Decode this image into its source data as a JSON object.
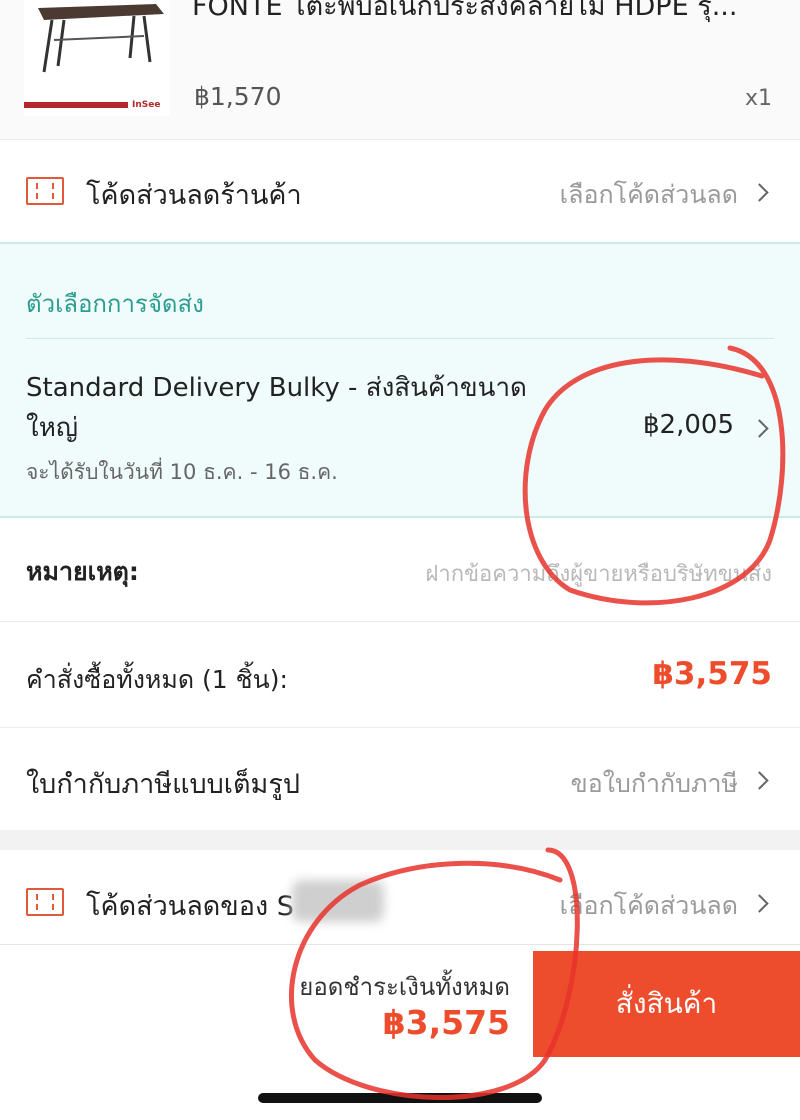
{
  "product": {
    "title": "FONTE โต๊ะพับอเนกประสงค์ลายไม้ HDPE รุ่...",
    "price": "฿1,570",
    "quantity": "x1",
    "thumb_brand": "InSee"
  },
  "shop_voucher": {
    "label": "โค้ดส่วนลดร้านค้า",
    "action": "เลือกโค้ดส่วนลด"
  },
  "delivery": {
    "header": "ตัวเลือกการจัดส่ง",
    "method_line1": "Standard Delivery Bulky - ส่งสินค้าขนาด",
    "method_line2": "ใหญ่",
    "price": "฿2,005",
    "eta": "จะได้รับในวันที่ 10 ธ.ค. - 16 ธ.ค."
  },
  "note": {
    "label": "หมายเหตุ:",
    "placeholder": "ฝากข้อความถึงผู้ขายหรือบริษัทขนส่ง"
  },
  "order_total": {
    "label": "คำสั่งซื้อทั้งหมด (1 ชิ้น):",
    "amount": "฿3,575"
  },
  "tax_invoice": {
    "label": "ใบกำกับภาษีแบบเต็มรูป",
    "action": "ขอใบกำกับภาษี"
  },
  "platform_voucher": {
    "label": "โค้ดส่วนลดของ S",
    "action": "เลือกโค้ดส่วนลด"
  },
  "bottom_bar": {
    "total_label": "ยอดชำระเงินทั้งหมด",
    "total_amount": "฿3,575",
    "order_button": "สั่งสินค้า"
  },
  "colors": {
    "accent": "#ee4d2d",
    "teal": "#2a9d8f",
    "annotation": "#e8322b"
  }
}
